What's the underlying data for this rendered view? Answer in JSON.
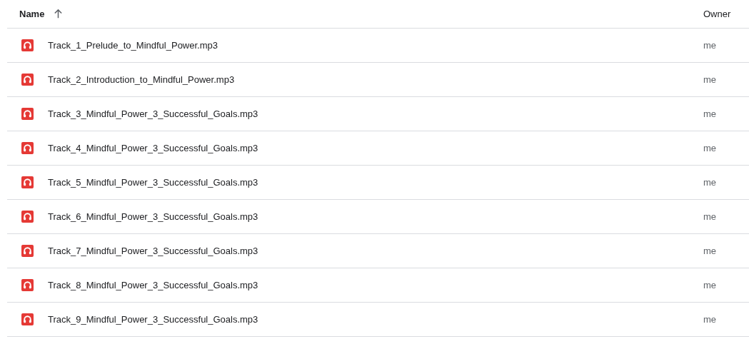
{
  "table": {
    "columns": [
      {
        "label": "Name",
        "sorted": true
      },
      {
        "label": "Owner"
      }
    ],
    "rows": [
      {
        "name": "Track_1_Prelude_to_Mindful_Power.mp3",
        "owner": "me"
      },
      {
        "name": "Track_2_Introduction_to_Mindful_Power.mp3",
        "owner": "me"
      },
      {
        "name": "Track_3_Mindful_Power_3_Successful_Goals.mp3",
        "owner": "me"
      },
      {
        "name": "Track_4_Mindful_Power_3_Successful_Goals.mp3",
        "owner": "me"
      },
      {
        "name": "Track_5_Mindful_Power_3_Successful_Goals.mp3",
        "owner": "me"
      },
      {
        "name": "Track_6_Mindful_Power_3_Successful_Goals.mp3",
        "owner": "me"
      },
      {
        "name": "Track_7_Mindful_Power_3_Successful_Goals.mp3",
        "owner": "me"
      },
      {
        "name": "Track_8_Mindful_Power_3_Successful_Goals.mp3",
        "owner": "me"
      },
      {
        "name": "Track_9_Mindful_Power_3_Successful_Goals.mp3",
        "owner": "me"
      }
    ]
  }
}
